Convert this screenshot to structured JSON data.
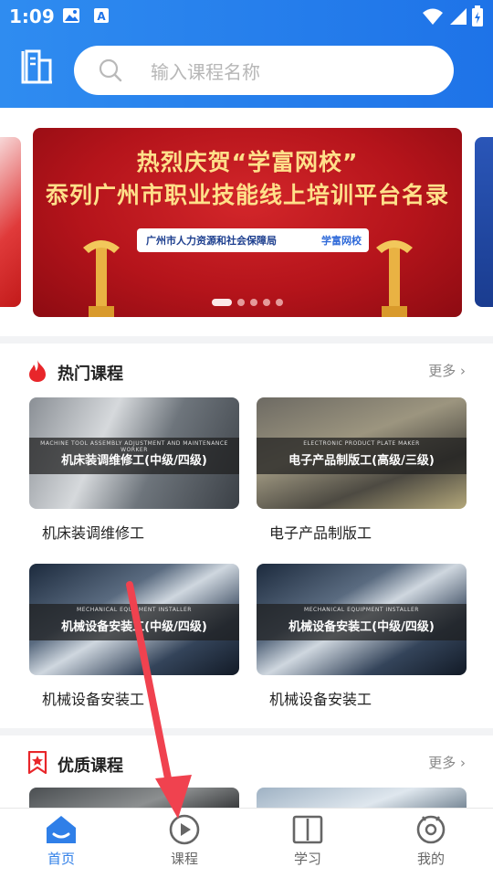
{
  "status_bar": {
    "time": "1:09"
  },
  "search": {
    "placeholder": "输入课程名称"
  },
  "banner": {
    "line1": "热烈庆贺“学富网校”",
    "line2": "忝列广州市职业技能线上培训平台名录",
    "org": "广州市人力资源和社会保障局",
    "brand": "学富网校",
    "slide_count": 5,
    "active_slide": 1
  },
  "hot_section": {
    "title": "热门课程",
    "more": "更多",
    "cards": [
      {
        "thumb_small": "MACHINE TOOL ASSEMBLY ADJUSTMENT AND MAINTENANCE WORKER",
        "thumb_title": "机床装调维修工(中级/四级)",
        "label": "机床装调维修工"
      },
      {
        "thumb_small": "ELECTRONIC PRODUCT PLATE MAKER",
        "thumb_title": "电子产品制版工(高级/三级)",
        "label": "电子产品制版工"
      },
      {
        "thumb_small": "MECHANICAL EQUIPMENT INSTALLER",
        "thumb_title": "机械设备安装工(中级/四级)",
        "label": "机械设备安装工"
      },
      {
        "thumb_small": "MECHANICAL EQUIPMENT INSTALLER",
        "thumb_title": "机械设备安装工(中级/四级)",
        "label": "机械设备安装工"
      }
    ]
  },
  "quality_section": {
    "title": "优质课程",
    "more": "更多"
  },
  "tabbar": {
    "tabs": [
      {
        "label": "首页",
        "icon": "home-icon",
        "active": true
      },
      {
        "label": "课程",
        "icon": "play-circle-icon",
        "active": false
      },
      {
        "label": "学习",
        "icon": "book-icon",
        "active": false
      },
      {
        "label": "我的",
        "icon": "profile-icon",
        "active": false
      }
    ]
  },
  "colors": {
    "accent": "#2f7fe8",
    "header": "#1e73e8",
    "fire": "#e8262a",
    "annotation_arrow": "#f0424f"
  }
}
